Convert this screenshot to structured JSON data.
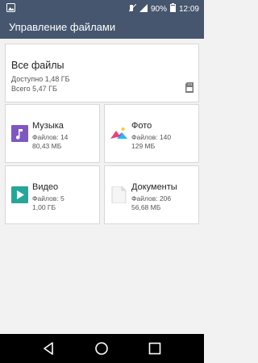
{
  "status_bar": {
    "battery_percent": "90%",
    "time": "12:09"
  },
  "app_bar": {
    "title": "Управление файлами"
  },
  "all_files": {
    "title": "Все файлы",
    "available": "Доступно 1,48 ГБ",
    "total": "Всего 5,47 ГБ"
  },
  "categories": [
    {
      "name": "Музыка",
      "files": "Файлов: 14",
      "size": "80,43 МБ",
      "icon": "music-icon",
      "color": "#7e57c2"
    },
    {
      "name": "Фото",
      "files": "Файлов: 140",
      "size": "129 МБ",
      "icon": "photo-icon",
      "color": "#ec407a"
    },
    {
      "name": "Видео",
      "files": "Файлов: 5",
      "size": "1,00 ГБ",
      "icon": "video-icon",
      "color": "#26a69a"
    },
    {
      "name": "Документы",
      "files": "Файлов: 206",
      "size": "56,68 МБ",
      "icon": "document-icon",
      "color": "#eeeeee"
    }
  ]
}
